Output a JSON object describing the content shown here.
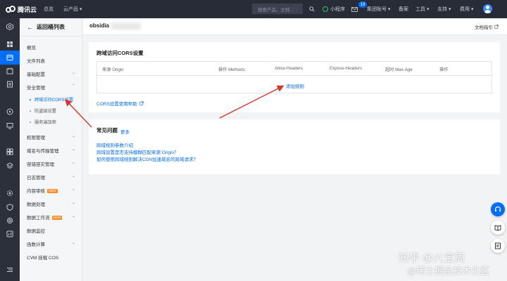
{
  "topbar": {
    "logo_text": "腾讯云",
    "nav": [
      "总览",
      "云产品"
    ],
    "search_placeholder": "搜索产品、文档…",
    "mini_program": "小程序",
    "message_count": "19",
    "group_account": "集团账号",
    "items": [
      "备案",
      "工具",
      "支持",
      "费用"
    ]
  },
  "sidebar": {
    "back_label": "返回桶列表",
    "items": [
      "概览",
      "文件列表",
      "基础配置",
      "安全管理"
    ],
    "security_sub": [
      "跨域访问CORS设置",
      "防盗链设置",
      "服务端加密"
    ],
    "more_items": [
      "权限管理",
      "域名与传输管理",
      "容错容灾管理",
      "日志管理",
      "内容审核",
      "数据处理",
      "数据工作流",
      "数据监控",
      "函数计算",
      "CVM 挂载 COS"
    ],
    "new_badge": "NEW"
  },
  "page": {
    "bucket_name": "obsidia",
    "doc_link": "文档指引"
  },
  "cors_card": {
    "title": "跨域访问CORS设置",
    "columns": [
      "来源 Origin",
      "操作 Methods",
      "Allow-Headers",
      "Expose-Headers",
      "超时 Max-Age",
      "操作"
    ],
    "add_rule": "添加规则",
    "help_link": "CORS设置使用帮助"
  },
  "faq_card": {
    "title": "常见问题",
    "more": "更多",
    "links": [
      "跨域规则参数介绍",
      "跨域设置是否支持模糊匹配来源 Origin？",
      "如何使用跨域规则解决CDN加速域名的跨域请求？"
    ]
  },
  "watermark": {
    "line1": "知乎 @八宝周",
    "line2": "@稀土掘金技术社区"
  },
  "colors": {
    "topbar": "#272c36",
    "rail": "#2b303a",
    "accent": "#006eff",
    "arrow": "#d9342b"
  }
}
